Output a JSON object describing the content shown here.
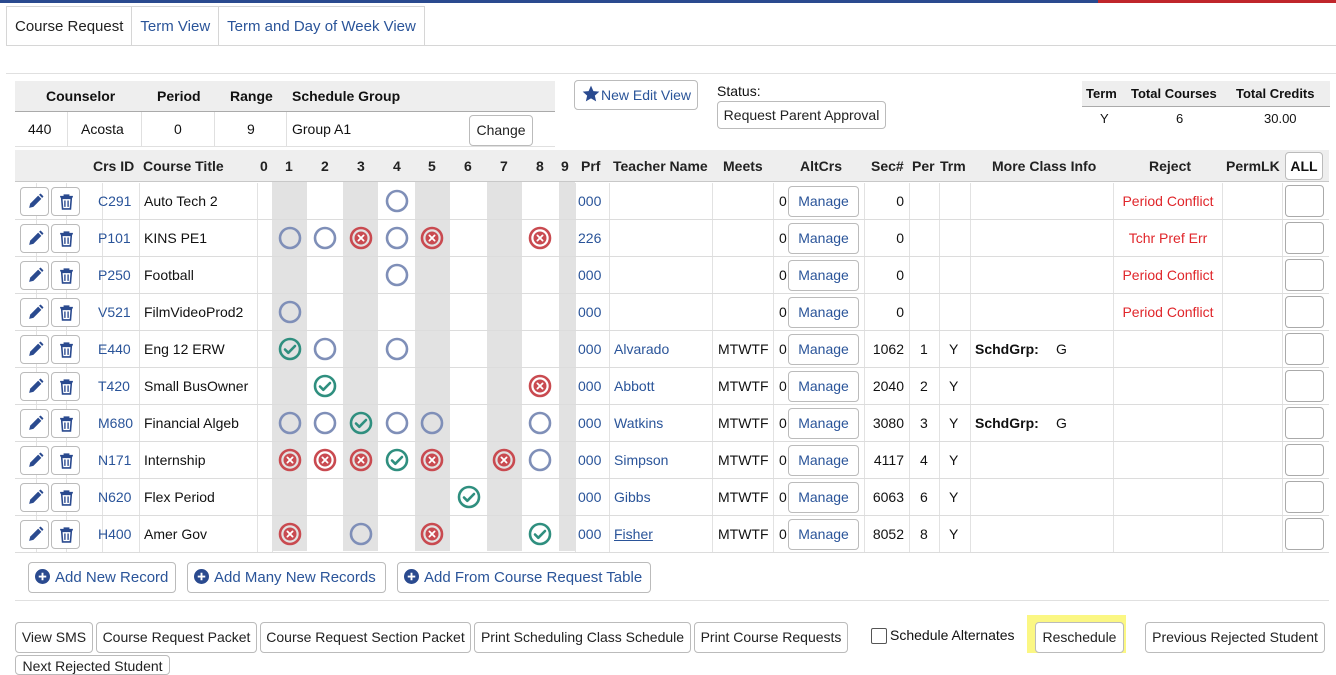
{
  "tabs": [
    "Course Request",
    "Term View",
    "Term and Day of Week View"
  ],
  "counselor": {
    "headers": [
      "Counselor",
      "Period",
      "Range",
      "Schedule Group"
    ],
    "values": [
      "440",
      "Acosta",
      "0",
      "9",
      "Group A1"
    ],
    "change_label": "Change"
  },
  "new_edit_view_label": "New Edit View",
  "status": {
    "label": "Status:",
    "value": "Request Parent Approval"
  },
  "totals": {
    "headers": [
      "Term",
      "Total Courses",
      "Total Credits"
    ],
    "values": [
      "Y",
      "6",
      "30.00"
    ]
  },
  "grid": {
    "headers": {
      "crs_id": "Crs ID",
      "course_title": "Course Title",
      "periods": [
        "0",
        "1",
        "2",
        "3",
        "4",
        "5",
        "6",
        "7",
        "8",
        "9"
      ],
      "prf": "Prf",
      "teacher": "Teacher Name",
      "meets": "Meets",
      "altcrs": "AltCrs",
      "sec": "Sec#",
      "per": "Per",
      "trm": "Trm",
      "more": "More Class Info",
      "reject": "Reject",
      "permlk": "PermLK",
      "all": "ALL"
    },
    "rows": [
      {
        "crs_id": "C291",
        "title": "Auto Tech 2",
        "marks": {
          "4": "empty"
        },
        "prf": "000",
        "teacher": "",
        "teacher_link": false,
        "meets": "",
        "alt": "0",
        "manage": "Manage",
        "sec": "0",
        "per": "",
        "trm": "",
        "more_label": "",
        "more_value": "",
        "reject": "Period Conflict"
      },
      {
        "crs_id": "P101",
        "title": "KINS PE1",
        "marks": {
          "1": "empty",
          "2": "empty",
          "3": "x",
          "4": "empty",
          "5": "x",
          "8": "x"
        },
        "prf": "226",
        "teacher": "",
        "teacher_link": false,
        "meets": "",
        "alt": "0",
        "manage": "Manage",
        "sec": "0",
        "per": "",
        "trm": "",
        "more_label": "",
        "more_value": "",
        "reject": "Tchr Pref Err"
      },
      {
        "crs_id": "P250",
        "title": "Football",
        "marks": {
          "4": "empty"
        },
        "prf": "000",
        "teacher": "",
        "teacher_link": false,
        "meets": "",
        "alt": "0",
        "manage": "Manage",
        "sec": "0",
        "per": "",
        "trm": "",
        "more_label": "",
        "more_value": "",
        "reject": "Period Conflict"
      },
      {
        "crs_id": "V521",
        "title": "FilmVideoProd2",
        "marks": {
          "1": "empty"
        },
        "prf": "000",
        "teacher": "",
        "teacher_link": false,
        "meets": "",
        "alt": "0",
        "manage": "Manage",
        "sec": "0",
        "per": "",
        "trm": "",
        "more_label": "",
        "more_value": "",
        "reject": "Period Conflict"
      },
      {
        "crs_id": "E440",
        "title": "Eng 12 ERW",
        "marks": {
          "1": "check",
          "2": "empty",
          "4": "empty"
        },
        "prf": "000",
        "teacher": "Alvarado",
        "teacher_link": false,
        "meets": "MTWTF",
        "alt": "0",
        "manage": "Manage",
        "sec": "1062",
        "per": "1",
        "trm": "Y",
        "more_label": "SchdGrp:",
        "more_value": "G",
        "reject": ""
      },
      {
        "crs_id": "T420",
        "title": "Small BusOwner",
        "marks": {
          "2": "check",
          "8": "x"
        },
        "prf": "000",
        "teacher": "Abbott",
        "teacher_link": false,
        "meets": "MTWTF",
        "alt": "0",
        "manage": "Manage",
        "sec": "2040",
        "per": "2",
        "trm": "Y",
        "more_label": "",
        "more_value": "",
        "reject": ""
      },
      {
        "crs_id": "M680",
        "title": "Financial Algeb",
        "marks": {
          "1": "empty",
          "2": "empty",
          "3": "check",
          "4": "empty",
          "5": "empty",
          "8": "empty"
        },
        "prf": "000",
        "teacher": "Watkins",
        "teacher_link": false,
        "meets": "MTWTF",
        "alt": "0",
        "manage": "Manage",
        "sec": "3080",
        "per": "3",
        "trm": "Y",
        "more_label": "SchdGrp:",
        "more_value": "G",
        "reject": ""
      },
      {
        "crs_id": "N171",
        "title": "Internship",
        "marks": {
          "1": "x",
          "2": "x",
          "3": "x",
          "4": "check",
          "5": "x",
          "7": "x",
          "8": "empty"
        },
        "prf": "000",
        "teacher": "Simpson",
        "teacher_link": false,
        "meets": "MTWTF",
        "alt": "0",
        "manage": "Manage",
        "sec": "4117",
        "per": "4",
        "trm": "Y",
        "more_label": "",
        "more_value": "",
        "reject": ""
      },
      {
        "crs_id": "N620",
        "title": "Flex Period",
        "marks": {
          "6": "check"
        },
        "prf": "000",
        "teacher": "Gibbs",
        "teacher_link": false,
        "meets": "MTWTF",
        "alt": "0",
        "manage": "Manage",
        "sec": "6063",
        "per": "6",
        "trm": "Y",
        "more_label": "",
        "more_value": "",
        "reject": ""
      },
      {
        "crs_id": "H400",
        "title": "Amer Gov",
        "marks": {
          "1": "x",
          "3": "empty",
          "5": "x",
          "8": "check"
        },
        "prf": "000",
        "teacher": "Fisher",
        "teacher_link": true,
        "meets": "MTWTF",
        "alt": "0",
        "manage": "Manage",
        "sec": "8052",
        "per": "8",
        "trm": "Y",
        "more_label": "",
        "more_value": "",
        "reject": ""
      }
    ]
  },
  "add_buttons": [
    "Add New Record",
    "Add Many New Records",
    "Add From Course Request Table"
  ],
  "bottom_buttons": [
    "View SMS",
    "Course Request Packet",
    "Course Request Section Packet",
    "Print Scheduling Class Schedule",
    "Print Course Requests"
  ],
  "schedule_alternates_label": "Schedule Alternates",
  "reschedule_label": "Reschedule",
  "previous_rejected_label": "Previous Rejected Student",
  "next_rejected_label": "Next Rejected Student",
  "colors": {
    "accent": "#2a5499",
    "reject": "#e0262b",
    "check": "#2f8f7f",
    "x": "#c94a50",
    "empty": "#7f8fb8",
    "highlight": "#fbf783"
  }
}
